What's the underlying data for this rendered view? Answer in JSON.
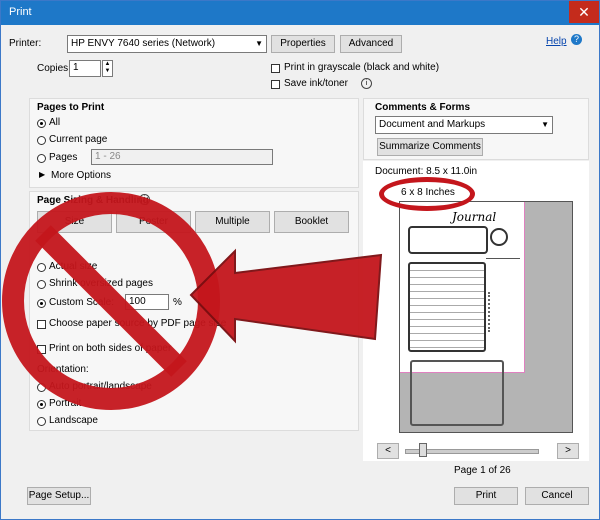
{
  "window": {
    "title": "Print",
    "close": "✕"
  },
  "printer": {
    "label": "Printer:",
    "value": "HP ENVY 7640 series (Network)",
    "properties": "Properties",
    "advanced": "Advanced",
    "help": "Help"
  },
  "copies": {
    "label": "Copies:",
    "value": "1"
  },
  "options": {
    "grayscale": "Print in grayscale (black and white)",
    "save_ink": "Save ink/toner"
  },
  "pages": {
    "title": "Pages to Print",
    "all": "All",
    "current": "Current page",
    "pages": "Pages",
    "range": "1 - 26",
    "more": "More Options"
  },
  "sizing": {
    "title": "Page Sizing & Handling",
    "size": "Size",
    "poster": "Poster",
    "multiple": "Multiple",
    "booklet": "Booklet",
    "actual": "Actual size",
    "shrink": "Shrink oversized pages",
    "custom": "Custom Scale:",
    "scale": "100",
    "percent": "%",
    "source": "Choose paper source by PDF page size",
    "duplex": "Print on both sides of paper",
    "orientation": "Orientation:",
    "auto": "Auto portrait/landscape",
    "portrait": "Portrait",
    "landscape": "Landscape"
  },
  "comments": {
    "title": "Comments & Forms",
    "value": "Document and Markups",
    "summarize": "Summarize Comments"
  },
  "preview": {
    "document": "Document: 8.5 x 11.0in",
    "annotation": "6 x 8 Inches",
    "journal": "Journal",
    "page_label": "Page 1 of 26",
    "prev": "<",
    "next": ">"
  },
  "footer": {
    "page_setup": "Page Setup...",
    "print": "Print",
    "cancel": "Cancel"
  },
  "colors": {
    "accent": "#1e78c8",
    "overlay": "#c4161c"
  }
}
